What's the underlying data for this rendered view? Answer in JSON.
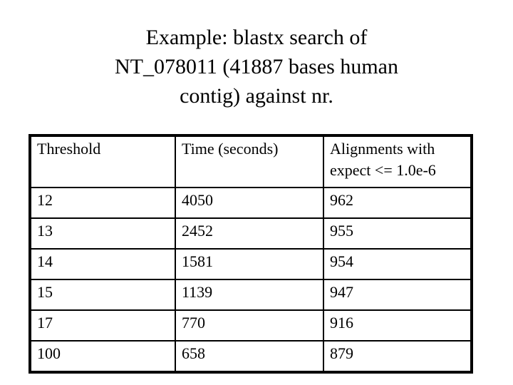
{
  "slide": {
    "title_lines": [
      "Example: blastx search of",
      "NT_078011 (41887 bases human",
      "contig) against nr."
    ],
    "background_color": "#ffffff",
    "text_color": "#000000"
  },
  "table": {
    "columns": [
      {
        "header_lines": [
          "Threshold"
        ]
      },
      {
        "header_lines": [
          "Time (seconds)"
        ]
      },
      {
        "header_lines": [
          "Alignments with",
          "expect <= 1.0e-6"
        ]
      }
    ],
    "rows": [
      {
        "threshold": "12",
        "time_seconds": "4050",
        "alignments": "962"
      },
      {
        "threshold": "13",
        "time_seconds": "2452",
        "alignments": "955"
      },
      {
        "threshold": "14",
        "time_seconds": "1581",
        "alignments": "954"
      },
      {
        "threshold": "15",
        "time_seconds": "1139",
        "alignments": "947"
      },
      {
        "threshold": "17",
        "time_seconds": "770",
        "alignments": "916"
      },
      {
        "threshold": "100",
        "time_seconds": "658",
        "alignments": "879"
      }
    ],
    "border_color": "#000000"
  },
  "chart_data": {
    "type": "table",
    "title": "Example: blastx search of NT_078011 (41887 bases human contig) against nr.",
    "columns": [
      "Threshold",
      "Time (seconds)",
      "Alignments with expect <= 1.0e-6"
    ],
    "rows": [
      [
        "12",
        "4050",
        "962"
      ],
      [
        "13",
        "2452",
        "955"
      ],
      [
        "14",
        "1581",
        "954"
      ],
      [
        "15",
        "1139",
        "947"
      ],
      [
        "17",
        "770",
        "916"
      ],
      [
        "100",
        "658",
        "879"
      ]
    ],
    "threshold": [
      12,
      13,
      14,
      15,
      17,
      100
    ],
    "time_seconds": [
      4050,
      2452,
      1581,
      1139,
      770,
      658
    ],
    "alignments_expect_le_1e6": [
      962,
      955,
      954,
      947,
      916,
      879
    ],
    "xlabel": "Threshold",
    "ylabel": "",
    "grid": true,
    "legend": "none"
  }
}
